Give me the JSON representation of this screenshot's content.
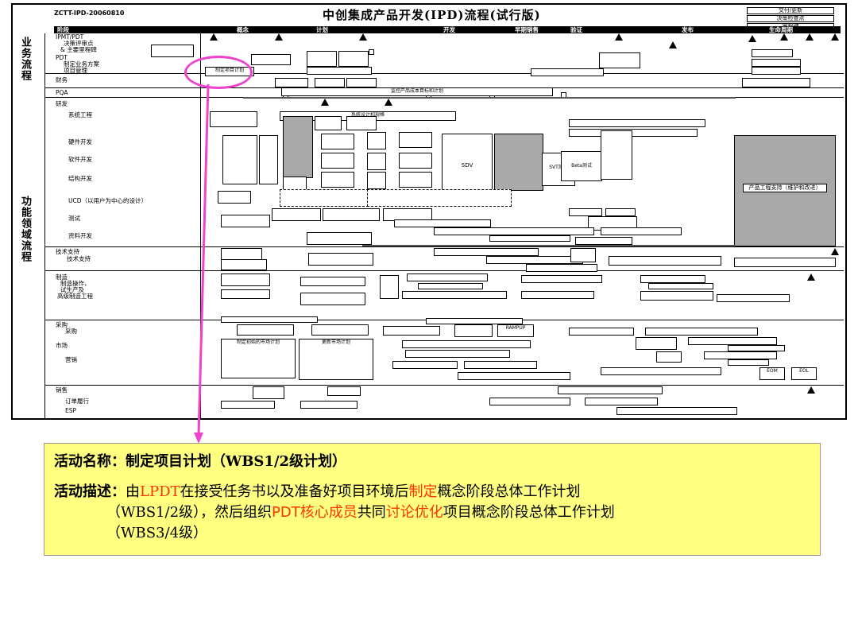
{
  "header": {
    "doc_id": "ZCTT-IPD-20060810",
    "title": "中创集成产品开发(IPD)流程(试行版)",
    "legend": [
      "交付/更新",
      "决策检查点",
      "里程碑"
    ]
  },
  "phases": [
    "阶段",
    "概念",
    "计划",
    "开发",
    "早期销售",
    "验证",
    "发布",
    "生命周期"
  ],
  "side_labels": {
    "business": "业务流程",
    "functional": "功能领域流程"
  },
  "rows": {
    "ipmt": "IPMT/PDT",
    "ipmt_sub1": "决策评审点",
    "ipmt_sub2": "& 主要里程碑",
    "pdt": "PDT",
    "pdt_sub1": "制定业务方案",
    "pdt_sub2": "项目管理",
    "finance": "财务",
    "pqa": "PQA",
    "rd": "研发",
    "sys_eng": "系统工程",
    "hw": "硬件开发",
    "sw": "软件开发",
    "struct": "结构开发",
    "ucd": "UCD（以用户为中心的设计）",
    "test": "测试",
    "docs": "资料开发",
    "tech_support": "技术支持",
    "tech_support_sub": "技术支持",
    "mfg": "制造",
    "mfg_sub1": "制造操作，",
    "mfg_sub2": "试生产及",
    "mfg_sub3": "高级制造工程",
    "purchase": "采购",
    "purchase_sub": "采购",
    "market": "市场",
    "market_sub": "营销",
    "sales": "销售",
    "sales_sub1": "订单履行",
    "sales_sub2": "ESP"
  },
  "boxes": {
    "wbs_box": "制定项目计划",
    "wbs_box_sub": "(WBS1/2级)",
    "monitor_bar": "监控产品成本目标和计划",
    "sdv": "SDV",
    "svt": "SVT测试",
    "beta": "Beta测试",
    "prod_eng": "产品工程支持（维护和改进）",
    "ramp": "RAMPUP",
    "sys_design": "系统设计和规格",
    "market_plan": "制定初始的市场计划",
    "update_market": "更新市场计划",
    "eom": "EOM",
    "eos": "EOS",
    "eol": "EOL",
    "ga": "GA",
    "dcp": "DCP"
  },
  "activity": {
    "name_label": "活动名称：",
    "name_value": "制定项目计划（",
    "name_mono": "WBS1/2",
    "name_tail": "级计划）",
    "desc_label": "活动描述：",
    "desc_p1": "由",
    "desc_lpdt": "LPDT",
    "desc_p2": "在接受任务书以及准备好项目环境后",
    "desc_hl1": "制定",
    "desc_p3": "概念阶段总体工作计划",
    "desc_p4a": "（WBS1/2级），然后组织",
    "desc_pdt": "PDT核心成员",
    "desc_p5": "共同",
    "desc_hl2": "讨论优化",
    "desc_p6": "项目概念阶段总体工作计划",
    "desc_p7": "（WBS3/4级）"
  },
  "colors": {
    "highlight": "#ee44cc",
    "note_bg": "#ffff80",
    "red_text": "#ff3300"
  }
}
